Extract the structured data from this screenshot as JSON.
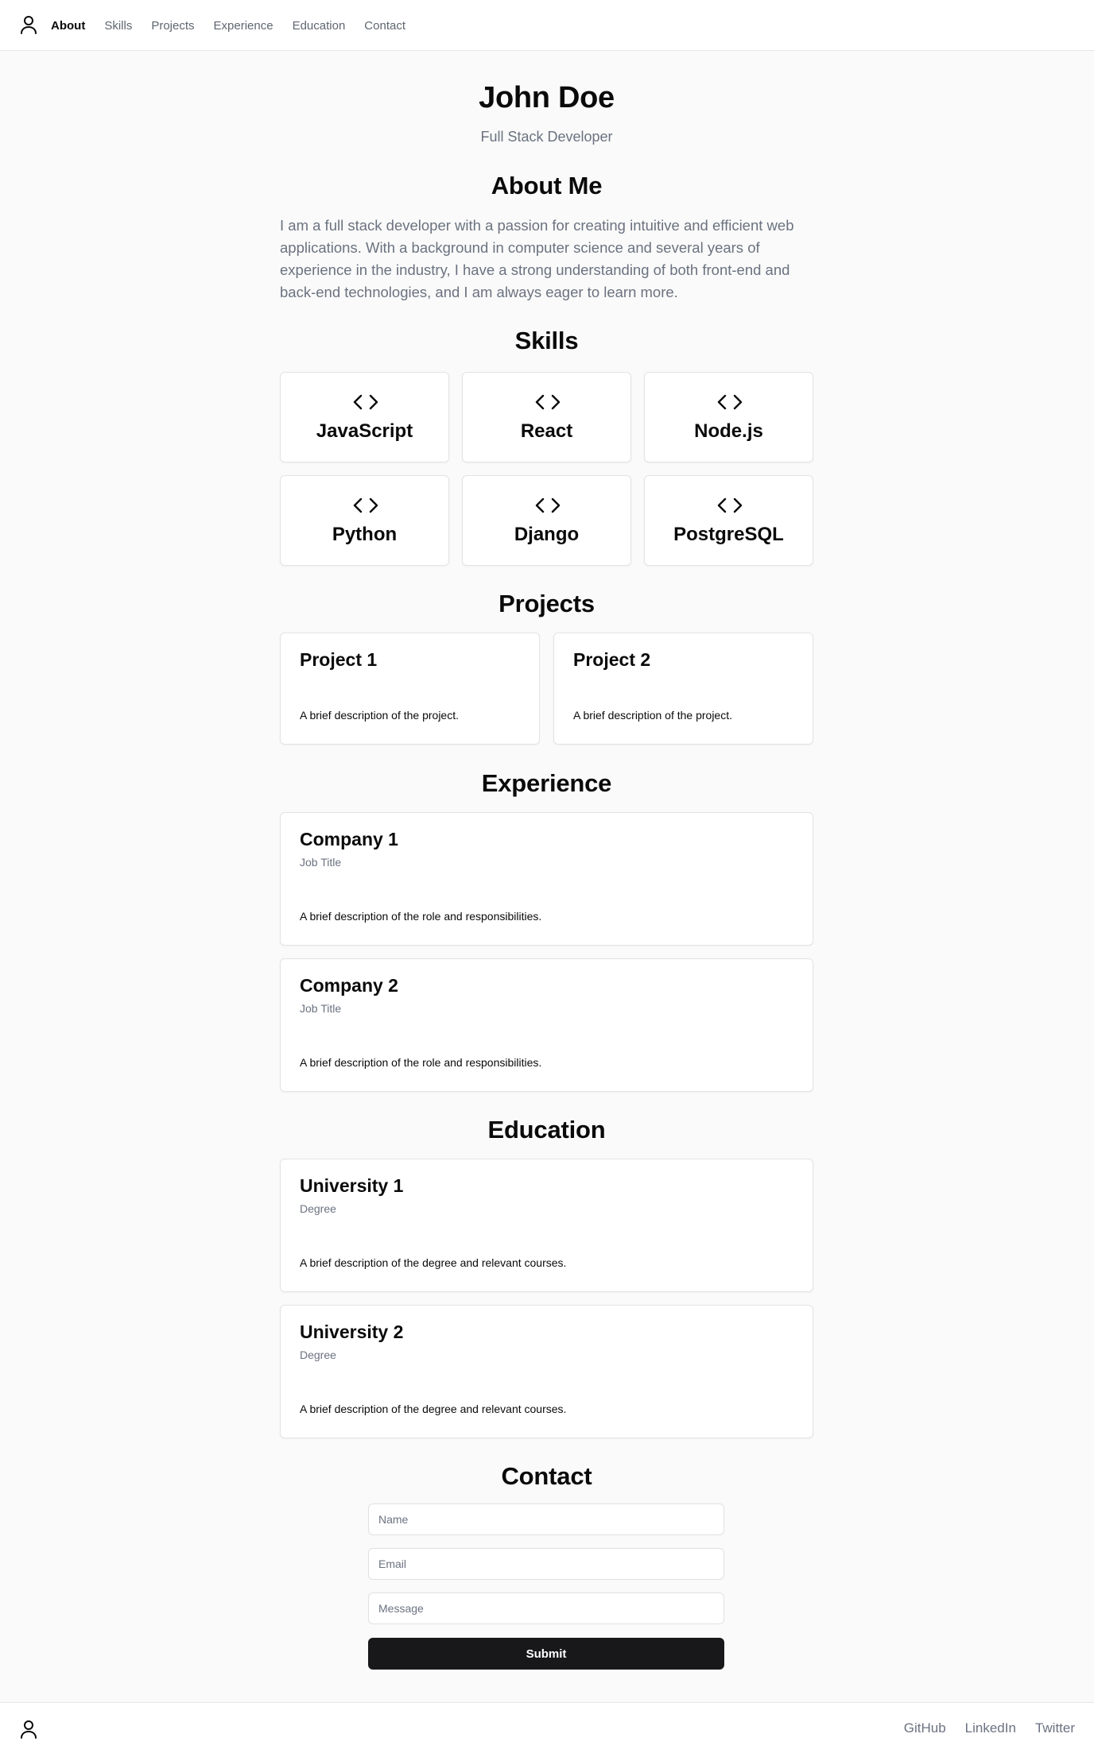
{
  "header": {
    "logo_icon": "user-icon",
    "nav": [
      {
        "label": "About",
        "active": true
      },
      {
        "label": "Skills",
        "active": false
      },
      {
        "label": "Projects",
        "active": false
      },
      {
        "label": "Experience",
        "active": false
      },
      {
        "label": "Education",
        "active": false
      },
      {
        "label": "Contact",
        "active": false
      }
    ]
  },
  "hero": {
    "name": "John Doe",
    "title": "Full Stack Developer"
  },
  "about": {
    "heading": "About Me",
    "text": "I am a full stack developer with a passion for creating intuitive and efficient web applications. With a background in computer science and several years of experience in the industry, I have a strong understanding of both front-end and back-end technologies, and I am always eager to learn more."
  },
  "skills": {
    "heading": "Skills",
    "icon": "code-icon",
    "items": [
      "JavaScript",
      "React",
      "Node.js",
      "Python",
      "Django",
      "PostgreSQL"
    ]
  },
  "projects": {
    "heading": "Projects",
    "items": [
      {
        "title": "Project 1",
        "description": "A brief description of the project."
      },
      {
        "title": "Project 2",
        "description": "A brief description of the project."
      }
    ]
  },
  "experience": {
    "heading": "Experience",
    "items": [
      {
        "company": "Company 1",
        "role": "Job Title",
        "description": "A brief description of the role and responsibilities."
      },
      {
        "company": "Company 2",
        "role": "Job Title",
        "description": "A brief description of the role and responsibilities."
      }
    ]
  },
  "education": {
    "heading": "Education",
    "items": [
      {
        "school": "University 1",
        "degree": "Degree",
        "description": "A brief description of the degree and relevant courses."
      },
      {
        "school": "University 2",
        "degree": "Degree",
        "description": "A brief description of the degree and relevant courses."
      }
    ]
  },
  "contact": {
    "heading": "Contact",
    "name_placeholder": "Name",
    "email_placeholder": "Email",
    "message_placeholder": "Message",
    "submit_label": "Submit"
  },
  "footer": {
    "logo_icon": "user-icon",
    "links": [
      "GitHub",
      "LinkedIn",
      "Twitter"
    ]
  },
  "colors": {
    "background": "#f9faf9",
    "text": "#0a0a0a",
    "muted": "#6b7280",
    "button": "#18181b"
  }
}
